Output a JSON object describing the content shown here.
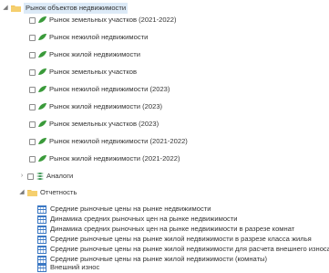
{
  "colors": {
    "folder": "#f2c45a",
    "leaf": "#3a9a3a",
    "table": "#3b78c4",
    "stack": "#2f8f4a",
    "selected": "#dceaf7"
  },
  "tree": {
    "root": {
      "label": "Рынок объектов недвижимости",
      "icon": "folder-icon",
      "expanded": true
    },
    "markets": [
      "Рынок земельных участков (2021-2022)",
      "Рынок нежилой недвижимости",
      "Рынок жилой недвижимости",
      "Рынок земельных участков",
      "Рынок нежилой недвижимости (2023)",
      "Рынок жилой недвижимости (2023)",
      "Рынок земельных участков (2023)",
      "Рынок нежилой недвижимости (2021-2022)",
      "Рынок жилой недвижимости (2021-2022)"
    ],
    "analogs": {
      "label": "Аналоги",
      "icon": "stack-icon",
      "expanded": false
    },
    "reports_folder": {
      "label": "Отчетность",
      "icon": "folder-icon",
      "expanded": true
    },
    "reports": [
      "Средние рыночные цены на рынке недвижимости",
      "Динамика средних рыночных цен на рынке недвижимости",
      "Динамика средних рыночных цен на рынке недвижимости в разрезе комнат",
      "Средние рыночные цены на рынке жилой недвижимости в разрезе класса жилья",
      "Средние рыночные цены на рынке жилой недвижимости для расчета внешнего износа",
      "Средние рыночные цены на рынке жилой недвижимости (комнаты)",
      "Внешний износ"
    ]
  }
}
